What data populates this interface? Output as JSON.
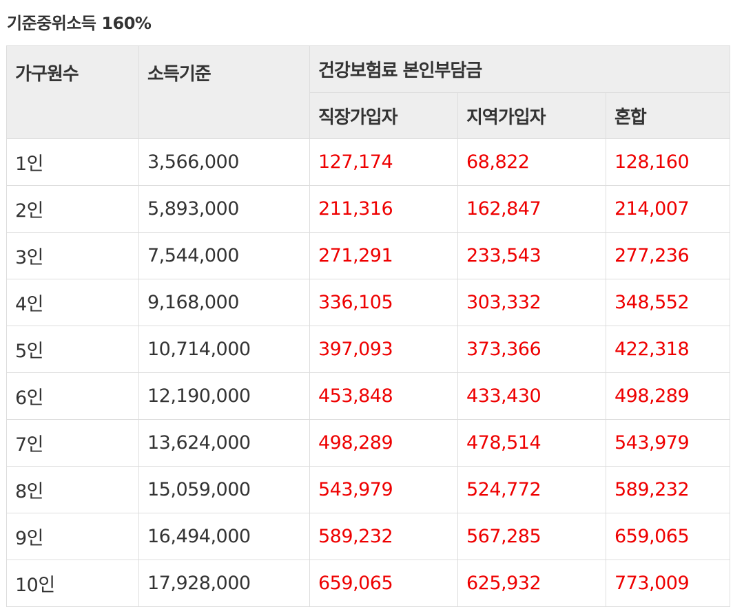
{
  "heading": "기준중위소득 160%",
  "table": {
    "headers": {
      "household": "가구원수",
      "income": "소득기준",
      "premium_group": "건강보험료 본인부담금",
      "employee": "직장가입자",
      "regional": "지역가입자",
      "mixed": "혼합"
    },
    "rows": [
      {
        "household": "1인",
        "income": "3,566,000",
        "employee": "127,174",
        "regional": "68,822",
        "mixed": "128,160"
      },
      {
        "household": "2인",
        "income": "5,893,000",
        "employee": "211,316",
        "regional": "162,847",
        "mixed": "214,007"
      },
      {
        "household": "3인",
        "income": "7,544,000",
        "employee": "271,291",
        "regional": "233,543",
        "mixed": "277,236"
      },
      {
        "household": "4인",
        "income": "9,168,000",
        "employee": "336,105",
        "regional": "303,332",
        "mixed": "348,552"
      },
      {
        "household": "5인",
        "income": "10,714,000",
        "employee": "397,093",
        "regional": "373,366",
        "mixed": "422,318"
      },
      {
        "household": "6인",
        "income": "12,190,000",
        "employee": "453,848",
        "regional": "433,430",
        "mixed": "498,289"
      },
      {
        "household": "7인",
        "income": "13,624,000",
        "employee": "498,289",
        "regional": "478,514",
        "mixed": "543,979"
      },
      {
        "household": "8인",
        "income": "15,059,000",
        "employee": "543,979",
        "regional": "524,772",
        "mixed": "589,232"
      },
      {
        "household": "9인",
        "income": "16,494,000",
        "employee": "589,232",
        "regional": "567,285",
        "mixed": "659,065"
      },
      {
        "household": "10인",
        "income": "17,928,000",
        "employee": "659,065",
        "regional": "625,932",
        "mixed": "773,009"
      }
    ]
  },
  "colors": {
    "value_text": "#ee0000",
    "header_bg": "#eeeeee",
    "border": "#dddddd",
    "text": "#333333"
  }
}
